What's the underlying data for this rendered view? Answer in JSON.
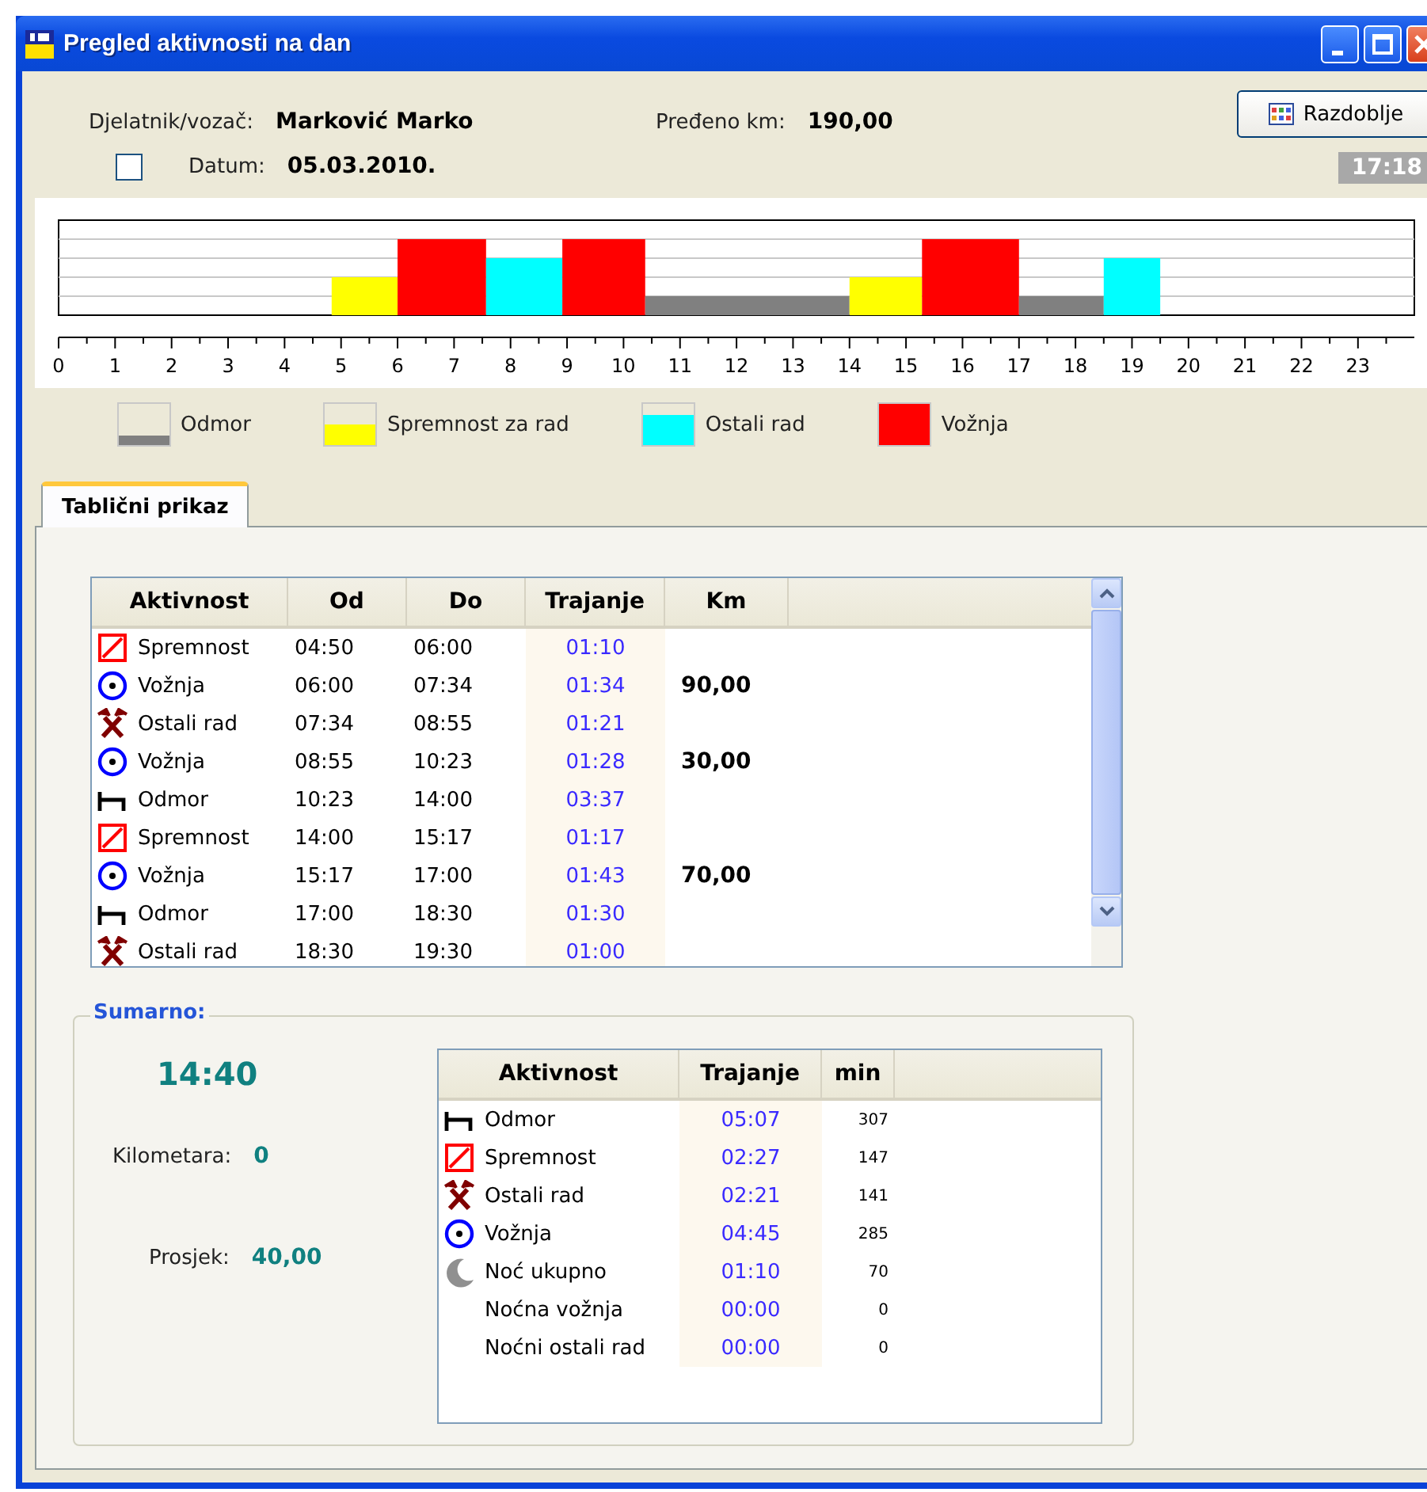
{
  "window": {
    "title": "Pregled aktivnosti na dan"
  },
  "header": {
    "driver_label": "Djelatnik/vozač:",
    "driver": "Marković Marko",
    "km_label": "Pređeno km:",
    "km": "190,00",
    "date_checked": false,
    "date_label": "Datum:",
    "date": "05.03.2010.",
    "period_button": "Razdoblje",
    "time": "17:18"
  },
  "timeline": {
    "hours": [
      "0",
      "1",
      "2",
      "3",
      "4",
      "5",
      "6",
      "7",
      "8",
      "9",
      "10",
      "11",
      "12",
      "13",
      "14",
      "15",
      "16",
      "17",
      "18",
      "19",
      "20",
      "21",
      "22",
      "23"
    ]
  },
  "legend": [
    {
      "kind": "odmor",
      "label": "Odmor",
      "color": "#808080"
    },
    {
      "kind": "spremnost",
      "label": "Spremnost za rad",
      "color": "#ffff00"
    },
    {
      "kind": "ostali",
      "label": "Ostali rad",
      "color": "#00ffff"
    },
    {
      "kind": "voznja",
      "label": "Vožnja",
      "color": "#ff0000"
    }
  ],
  "tabs": [
    {
      "label": "Tablični prikaz",
      "selected": true
    }
  ],
  "table": {
    "columns": [
      "Aktivnost",
      "Od",
      "Do",
      "Trajanje",
      "Km"
    ],
    "rows": [
      {
        "kind": "spremnost",
        "activity": "Spremnost",
        "from": "04:50",
        "to": "06:00",
        "duration": "01:10"
      },
      {
        "kind": "voznja",
        "activity": "Vožnja",
        "from": "06:00",
        "to": "07:34",
        "duration": "01:34",
        "km": "90,00"
      },
      {
        "kind": "ostali",
        "activity": "Ostali rad",
        "from": "07:34",
        "to": "08:55",
        "duration": "01:21"
      },
      {
        "kind": "voznja",
        "activity": "Vožnja",
        "from": "08:55",
        "to": "10:23",
        "duration": "01:28",
        "km": "30,00"
      },
      {
        "kind": "odmor",
        "activity": "Odmor",
        "from": "10:23",
        "to": "14:00",
        "duration": "03:37"
      },
      {
        "kind": "spremnost",
        "activity": "Spremnost",
        "from": "14:00",
        "to": "15:17",
        "duration": "01:17"
      },
      {
        "kind": "voznja",
        "activity": "Vožnja",
        "from": "15:17",
        "to": "17:00",
        "duration": "01:43",
        "km": "70,00"
      },
      {
        "kind": "odmor",
        "activity": "Odmor",
        "from": "17:00",
        "to": "18:30",
        "duration": "01:30"
      },
      {
        "kind": "ostali",
        "activity": "Ostali rad",
        "from": "18:30",
        "to": "19:30",
        "duration": "01:00"
      }
    ]
  },
  "summary": {
    "title": "Sumarno:",
    "total": "14:40",
    "km_label": "Kilometara:",
    "km": "0",
    "avg_label": "Prosjek:",
    "avg": "40,00",
    "columns": [
      "Aktivnost",
      "Trajanje",
      "min"
    ],
    "rows": [
      {
        "kind": "odmor",
        "activity": "Odmor",
        "duration": "05:07",
        "min": "307"
      },
      {
        "kind": "spremnost",
        "activity": "Spremnost",
        "duration": "02:27",
        "min": "147"
      },
      {
        "kind": "ostali",
        "activity": "Ostali rad",
        "duration": "02:21",
        "min": "141"
      },
      {
        "kind": "voznja",
        "activity": "Vožnja",
        "duration": "04:45",
        "min": "285"
      },
      {
        "kind": "noc",
        "activity": "Noć ukupno",
        "duration": "01:10",
        "min": "70"
      },
      {
        "kind": "none",
        "activity": "Noćna vožnja",
        "duration": "00:00",
        "min": "0"
      },
      {
        "kind": "none",
        "activity": "Noćni ostali rad",
        "duration": "00:00",
        "min": "0"
      }
    ]
  }
}
